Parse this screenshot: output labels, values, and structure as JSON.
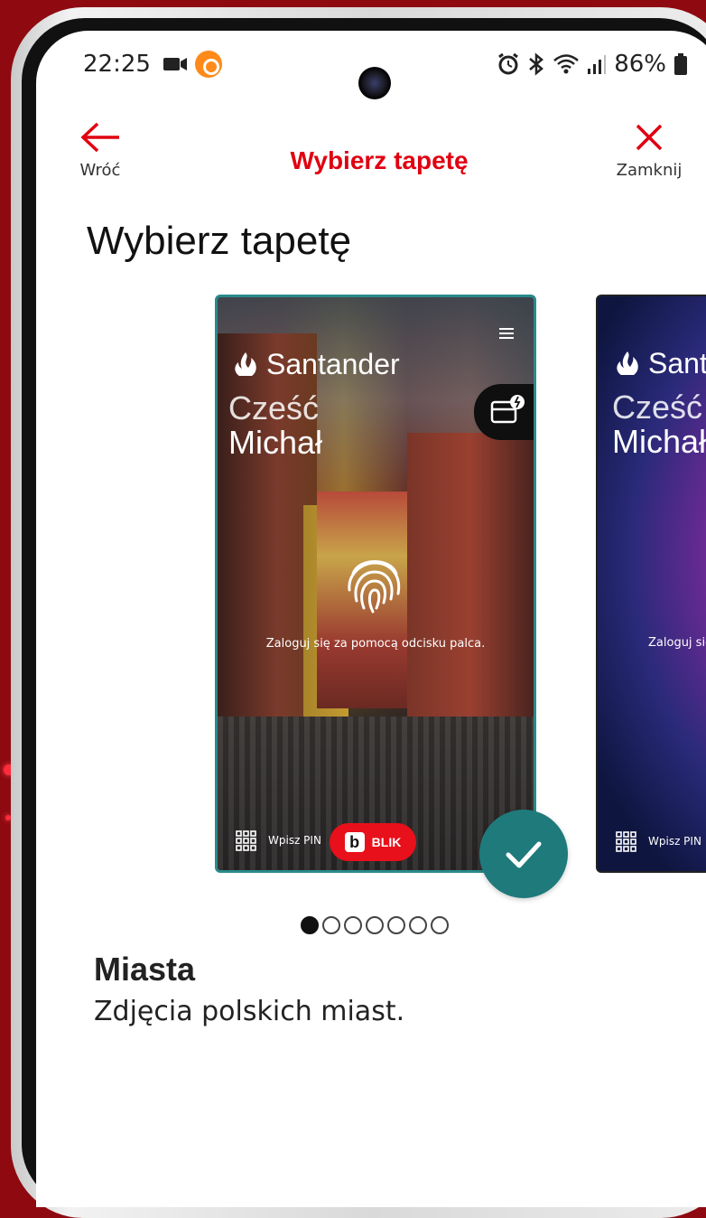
{
  "status_bar": {
    "time": "22:25",
    "battery": "86%"
  },
  "header": {
    "back_label": "Wróć",
    "title": "Wybierz tapetę",
    "close_label": "Zamknij"
  },
  "page_title": "Wybierz tapetę",
  "carousel": {
    "cards": [
      {
        "brand": "Santander",
        "greeting": "Cześć",
        "name": "Michał",
        "login_text": "Zaloguj się za pomocą odcisku palca.",
        "pin_label": "Wpisz PIN",
        "blik_label": "BLIK",
        "selected": true
      },
      {
        "brand": "Santander",
        "greeting": "Cześć",
        "name": "Michał",
        "login_text": "Zaloguj się za pomocą odcisku palca.",
        "pin_label": "Wpisz PIN",
        "selected": false
      }
    ],
    "page_count": 7,
    "active_page": 1
  },
  "selection": {
    "name": "Miasta",
    "description": "Zdjęcia polskich miast."
  },
  "colors": {
    "accent": "#e00010",
    "selected_border": "#2a8a8a",
    "check_badge": "#1f7a7c",
    "background": "#8e0a10"
  },
  "icons": {
    "back": "arrow-left-icon",
    "close": "close-icon",
    "check": "checkmark-icon",
    "fingerprint": "fingerprint-icon",
    "blik": "blik-icon",
    "keypad": "grid-icon"
  }
}
